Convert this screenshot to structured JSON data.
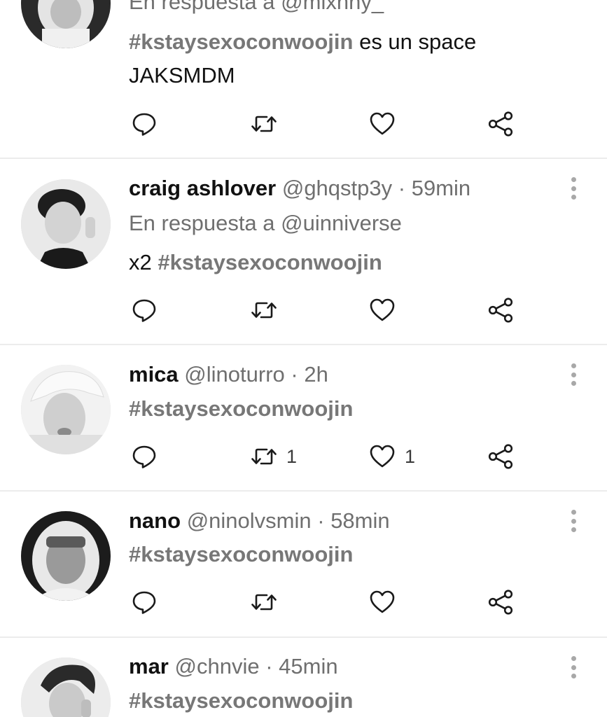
{
  "tweets": [
    {
      "reply_prefix": "En respuesta a",
      "reply_to": "@mixnny_",
      "hashtag": "#kstaysexoconwoojin",
      "text_after": "es un space",
      "text_line2": "JAKSMDM",
      "actions": {
        "reply": "",
        "retweet": "",
        "like": "",
        "share": ""
      }
    },
    {
      "name": "craig ashlover",
      "handle": "@ghqstp3y",
      "sep": "·",
      "time": "59min",
      "reply_prefix": "En respuesta a",
      "reply_to": "@uinniverse",
      "text_before": "x2",
      "hashtag": "#kstaysexoconwoojin",
      "actions": {
        "reply": "",
        "retweet": "",
        "like": "",
        "share": ""
      }
    },
    {
      "name": "mica",
      "handle": "@linoturro",
      "sep": "·",
      "time": "2h",
      "hashtag": "#kstaysexoconwoojin",
      "actions": {
        "reply": "",
        "retweet": "1",
        "like": "1",
        "share": ""
      }
    },
    {
      "name": "nano",
      "handle": "@ninolvsmin",
      "sep": "·",
      "time": "58min",
      "hashtag": "#kstaysexoconwoojin",
      "actions": {
        "reply": "",
        "retweet": "",
        "like": "",
        "share": ""
      }
    },
    {
      "name": "mar",
      "handle": "@chnvie",
      "sep": "·",
      "time": "45min",
      "hashtag": "#kstaysexoconwoojin"
    }
  ],
  "icons": {
    "reply": "reply-icon",
    "retweet": "retweet-icon",
    "like": "heart-icon",
    "share": "share-icon",
    "more": "more-options-icon"
  },
  "colors": {
    "text": "#111111",
    "muted": "#6f6f6f",
    "hashtag": "#777777",
    "divider": "#ececec",
    "icon": "#1a1a1a"
  }
}
